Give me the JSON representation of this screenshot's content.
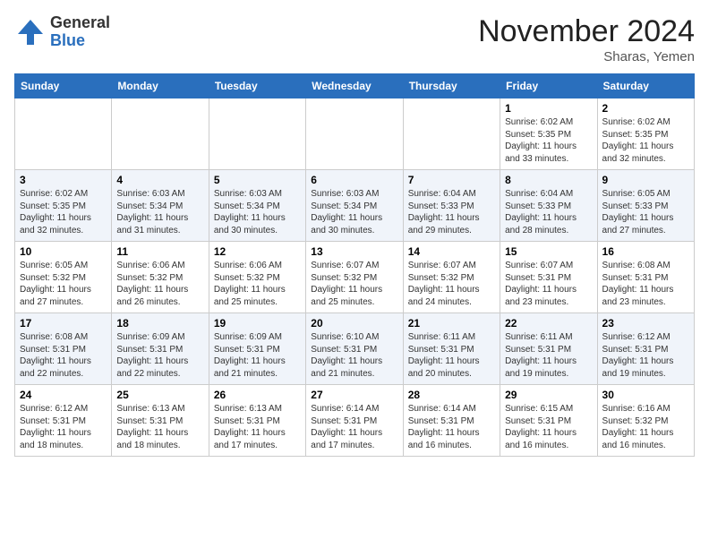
{
  "header": {
    "logo_general": "General",
    "logo_blue": "Blue",
    "month_title": "November 2024",
    "location": "Sharas, Yemen"
  },
  "days_of_week": [
    "Sunday",
    "Monday",
    "Tuesday",
    "Wednesday",
    "Thursday",
    "Friday",
    "Saturday"
  ],
  "weeks": [
    [
      {
        "day": "",
        "info": ""
      },
      {
        "day": "",
        "info": ""
      },
      {
        "day": "",
        "info": ""
      },
      {
        "day": "",
        "info": ""
      },
      {
        "day": "",
        "info": ""
      },
      {
        "day": "1",
        "info": "Sunrise: 6:02 AM\nSunset: 5:35 PM\nDaylight: 11 hours\nand 33 minutes."
      },
      {
        "day": "2",
        "info": "Sunrise: 6:02 AM\nSunset: 5:35 PM\nDaylight: 11 hours\nand 32 minutes."
      }
    ],
    [
      {
        "day": "3",
        "info": "Sunrise: 6:02 AM\nSunset: 5:35 PM\nDaylight: 11 hours\nand 32 minutes."
      },
      {
        "day": "4",
        "info": "Sunrise: 6:03 AM\nSunset: 5:34 PM\nDaylight: 11 hours\nand 31 minutes."
      },
      {
        "day": "5",
        "info": "Sunrise: 6:03 AM\nSunset: 5:34 PM\nDaylight: 11 hours\nand 30 minutes."
      },
      {
        "day": "6",
        "info": "Sunrise: 6:03 AM\nSunset: 5:34 PM\nDaylight: 11 hours\nand 30 minutes."
      },
      {
        "day": "7",
        "info": "Sunrise: 6:04 AM\nSunset: 5:33 PM\nDaylight: 11 hours\nand 29 minutes."
      },
      {
        "day": "8",
        "info": "Sunrise: 6:04 AM\nSunset: 5:33 PM\nDaylight: 11 hours\nand 28 minutes."
      },
      {
        "day": "9",
        "info": "Sunrise: 6:05 AM\nSunset: 5:33 PM\nDaylight: 11 hours\nand 27 minutes."
      }
    ],
    [
      {
        "day": "10",
        "info": "Sunrise: 6:05 AM\nSunset: 5:32 PM\nDaylight: 11 hours\nand 27 minutes."
      },
      {
        "day": "11",
        "info": "Sunrise: 6:06 AM\nSunset: 5:32 PM\nDaylight: 11 hours\nand 26 minutes."
      },
      {
        "day": "12",
        "info": "Sunrise: 6:06 AM\nSunset: 5:32 PM\nDaylight: 11 hours\nand 25 minutes."
      },
      {
        "day": "13",
        "info": "Sunrise: 6:07 AM\nSunset: 5:32 PM\nDaylight: 11 hours\nand 25 minutes."
      },
      {
        "day": "14",
        "info": "Sunrise: 6:07 AM\nSunset: 5:32 PM\nDaylight: 11 hours\nand 24 minutes."
      },
      {
        "day": "15",
        "info": "Sunrise: 6:07 AM\nSunset: 5:31 PM\nDaylight: 11 hours\nand 23 minutes."
      },
      {
        "day": "16",
        "info": "Sunrise: 6:08 AM\nSunset: 5:31 PM\nDaylight: 11 hours\nand 23 minutes."
      }
    ],
    [
      {
        "day": "17",
        "info": "Sunrise: 6:08 AM\nSunset: 5:31 PM\nDaylight: 11 hours\nand 22 minutes."
      },
      {
        "day": "18",
        "info": "Sunrise: 6:09 AM\nSunset: 5:31 PM\nDaylight: 11 hours\nand 22 minutes."
      },
      {
        "day": "19",
        "info": "Sunrise: 6:09 AM\nSunset: 5:31 PM\nDaylight: 11 hours\nand 21 minutes."
      },
      {
        "day": "20",
        "info": "Sunrise: 6:10 AM\nSunset: 5:31 PM\nDaylight: 11 hours\nand 21 minutes."
      },
      {
        "day": "21",
        "info": "Sunrise: 6:11 AM\nSunset: 5:31 PM\nDaylight: 11 hours\nand 20 minutes."
      },
      {
        "day": "22",
        "info": "Sunrise: 6:11 AM\nSunset: 5:31 PM\nDaylight: 11 hours\nand 19 minutes."
      },
      {
        "day": "23",
        "info": "Sunrise: 6:12 AM\nSunset: 5:31 PM\nDaylight: 11 hours\nand 19 minutes."
      }
    ],
    [
      {
        "day": "24",
        "info": "Sunrise: 6:12 AM\nSunset: 5:31 PM\nDaylight: 11 hours\nand 18 minutes."
      },
      {
        "day": "25",
        "info": "Sunrise: 6:13 AM\nSunset: 5:31 PM\nDaylight: 11 hours\nand 18 minutes."
      },
      {
        "day": "26",
        "info": "Sunrise: 6:13 AM\nSunset: 5:31 PM\nDaylight: 11 hours\nand 17 minutes."
      },
      {
        "day": "27",
        "info": "Sunrise: 6:14 AM\nSunset: 5:31 PM\nDaylight: 11 hours\nand 17 minutes."
      },
      {
        "day": "28",
        "info": "Sunrise: 6:14 AM\nSunset: 5:31 PM\nDaylight: 11 hours\nand 16 minutes."
      },
      {
        "day": "29",
        "info": "Sunrise: 6:15 AM\nSunset: 5:31 PM\nDaylight: 11 hours\nand 16 minutes."
      },
      {
        "day": "30",
        "info": "Sunrise: 6:16 AM\nSunset: 5:32 PM\nDaylight: 11 hours\nand 16 minutes."
      }
    ]
  ]
}
